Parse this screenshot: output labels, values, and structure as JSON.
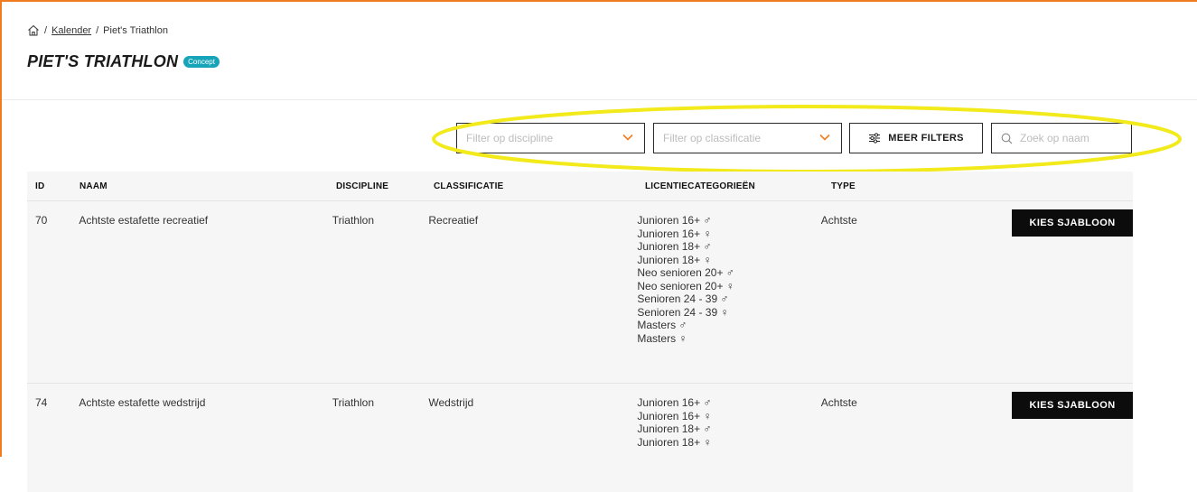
{
  "breadcrumb": {
    "link": "Kalender",
    "separator1": "/",
    "separator2": "/",
    "current": "Piet's Triathlon"
  },
  "page": {
    "title": "PIET'S TRIATHLON",
    "status_badge": "Concept"
  },
  "filters": {
    "discipline_placeholder": "Filter op discipline",
    "classification_placeholder": "Filter op classificatie",
    "more_filters_label": "MEER FILTERS",
    "search_placeholder": "Zoek op naam"
  },
  "table": {
    "headers": {
      "id": "ID",
      "naam": "NAAM",
      "discipline": "DISCIPLINE",
      "classificatie": "CLASSIFICATIE",
      "licentie": "LICENTIECATEGORIEËN",
      "type": "TYPE"
    },
    "rows": [
      {
        "id": "70",
        "naam": "Achtste estafette recreatief",
        "discipline": "Triathlon",
        "classificatie": "Recreatief",
        "licentie": [
          "Junioren 16+ ♂",
          "Junioren 16+ ♀",
          "Junioren 18+ ♂",
          "Junioren 18+ ♀",
          "Neo senioren 20+ ♂",
          "Neo senioren 20+ ♀",
          "Senioren 24 - 39 ♂",
          "Senioren 24 - 39 ♀",
          "Masters ♂",
          "Masters ♀"
        ],
        "type": "Achtste",
        "action": "KIES SJABLOON"
      },
      {
        "id": "74",
        "naam": "Achtste estafette wedstrijd",
        "discipline": "Triathlon",
        "classificatie": "Wedstrijd",
        "licentie": [
          "Junioren 16+ ♂",
          "Junioren 16+ ♀",
          "Junioren 18+ ♂",
          "Junioren 18+ ♀"
        ],
        "type": "Achtste",
        "action": "KIES SJABLOON"
      }
    ]
  },
  "colors": {
    "accent_border": "#f07c1f",
    "badge": "#15a4b8",
    "highlight": "#f2ea1a",
    "button": "#0c0c0c"
  },
  "icons": {
    "home": "home-icon",
    "chevron": "chevron-down-icon",
    "filters": "sliders-icon",
    "search": "search-icon"
  }
}
